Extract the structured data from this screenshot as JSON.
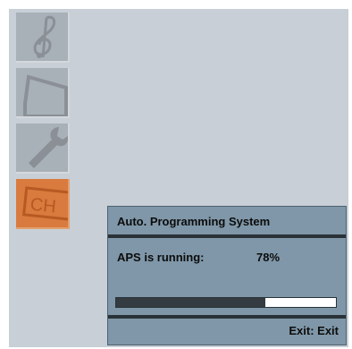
{
  "menu": {
    "items": [
      {
        "icon": "music-clef-icon",
        "active": false
      },
      {
        "icon": "tv-screen-icon",
        "active": false
      },
      {
        "icon": "wrench-icon",
        "active": false
      },
      {
        "icon": "channel-icon",
        "active": true,
        "glyph_text": "CH"
      }
    ]
  },
  "aps_dialog": {
    "title": "Auto. Programming System",
    "status_label": "APS is running:",
    "percent_text": "78%",
    "progress_fraction": 0.68,
    "exit_hint": "Exit: Exit"
  },
  "colors": {
    "screen_bg": "#c8cfd6",
    "icon_tile": "#a8b0b8",
    "active_tile": "#d97a3e",
    "dialog_bg": "#7f97a8",
    "dialog_bar": "#2a3238"
  }
}
